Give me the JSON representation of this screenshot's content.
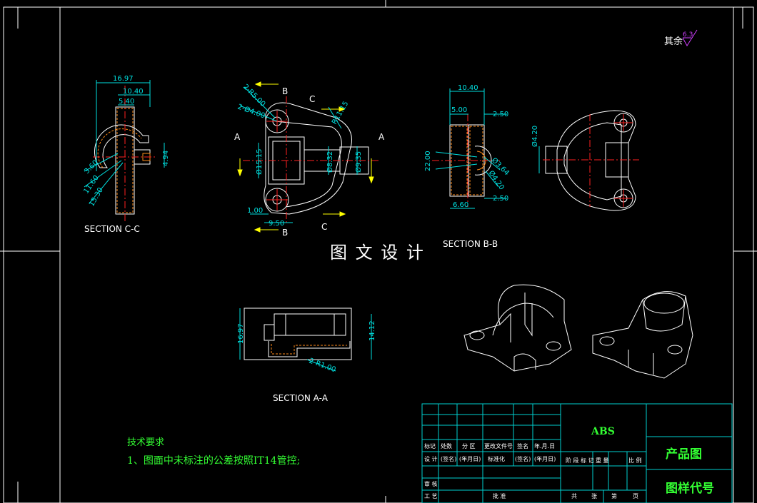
{
  "colors": {
    "background": "#000000",
    "outline": "#ffffff",
    "dimension": "#00e0e0",
    "centerline": "#ff2020",
    "leader": "#ffff00",
    "hatch": "#ff8c1a",
    "note": "#33ff33",
    "title_table": "#00d0d0",
    "title_text": "#33ff33",
    "roughness": "#d040ff"
  },
  "roughness": {
    "prefix": "其余",
    "value": "6.3"
  },
  "section_cc": {
    "label": "SECTION C-C",
    "dims": [
      "16.97",
      "10.40",
      "5.40",
      "4.94",
      "3.60",
      "11.60",
      "15.30"
    ]
  },
  "front_view": {
    "markers": [
      "A",
      "A",
      "B",
      "B",
      "C",
      "C"
    ],
    "dims": [
      "2-R5.00",
      "2-Ø4.00",
      "R11.15",
      "Ø15.15",
      "Ø8.32",
      "Ø9.35",
      "1.00",
      "9.50"
    ]
  },
  "section_bb": {
    "label": "SECTION B-B",
    "dims": [
      "10.40",
      "5.00",
      "2.50",
      "22.00",
      "Ø3.64",
      "Ø4.20",
      "2.50",
      "6.60"
    ]
  },
  "side_view": {
    "dims": [
      "Ø4.20"
    ]
  },
  "section_aa": {
    "label": "SECTION A-A",
    "dims": [
      "16.97",
      "14.12",
      "2-R1.00"
    ]
  },
  "watermark": "图 文 设 计",
  "tech_notes": {
    "heading": "技术要求",
    "item": "1、图面中未标注的公差按照IT14管控;"
  },
  "title_block": {
    "material": "ABS",
    "product": "产品图",
    "drawing_code": "图样代号",
    "row_labels": [
      "标记",
      "处数",
      "分 区",
      "更改文件号",
      "签名",
      "年.月.日"
    ],
    "design_row": [
      "设 计",
      "(签名)",
      "(年月日)",
      "标准化",
      "(签名)",
      "(年月日)"
    ],
    "stage_labels": [
      "阶 段 标 记",
      "重 量",
      "比 例"
    ],
    "review": "审 核",
    "craft": "工 艺",
    "approve": "批 准",
    "sheets": [
      "共",
      "张",
      "第",
      "页"
    ]
  }
}
